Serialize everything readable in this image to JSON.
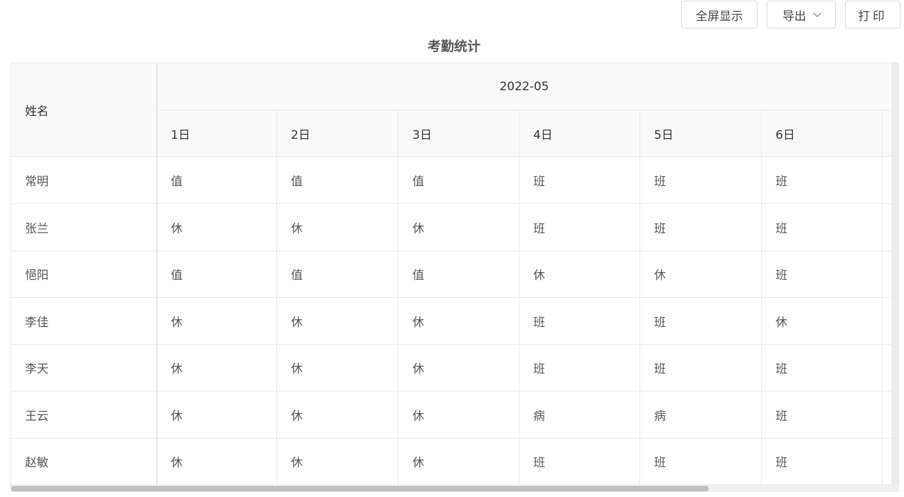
{
  "toolbar": {
    "fullscreen_label": "全屏显示",
    "export_label": "导出",
    "print_label": "打印"
  },
  "title": "考勤统计",
  "table": {
    "name_header": "姓名",
    "month": "2022-05",
    "days": [
      "1日",
      "2日",
      "3日",
      "4日",
      "5日",
      "6日"
    ],
    "rows": [
      {
        "name": "常明",
        "cells": [
          "值",
          "值",
          "值",
          "班",
          "班",
          "班"
        ]
      },
      {
        "name": "张兰",
        "cells": [
          "休",
          "休",
          "休",
          "班",
          "班",
          "班"
        ]
      },
      {
        "name": "悒阳",
        "cells": [
          "值",
          "值",
          "值",
          "休",
          "休",
          "班"
        ]
      },
      {
        "name": "李佳",
        "cells": [
          "休",
          "休",
          "休",
          "班",
          "班",
          "休"
        ]
      },
      {
        "name": "李天",
        "cells": [
          "休",
          "休",
          "休",
          "班",
          "班",
          "班"
        ]
      },
      {
        "name": "王云",
        "cells": [
          "休",
          "休",
          "休",
          "病",
          "病",
          "班"
        ]
      },
      {
        "name": "赵敏",
        "cells": [
          "休",
          "休",
          "休",
          "班",
          "班",
          "班"
        ]
      }
    ]
  },
  "scroll": {
    "horizontal_position": 0
  }
}
